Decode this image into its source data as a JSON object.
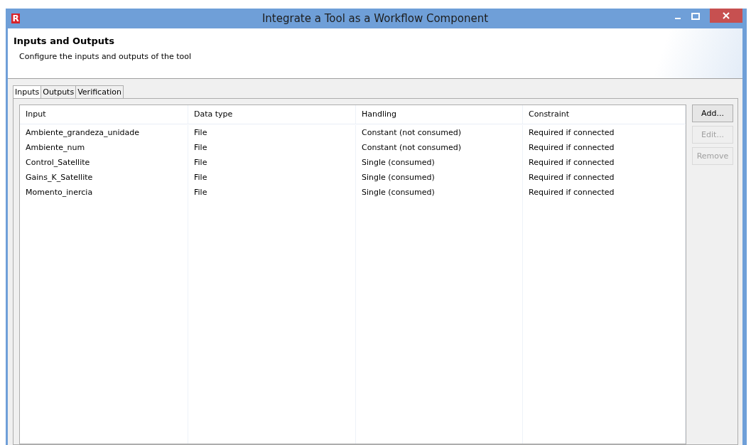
{
  "window": {
    "title": "Integrate a Tool as a Workflow Component",
    "logo": "R"
  },
  "header": {
    "title": "Inputs and Outputs",
    "description": "Configure the inputs and outputs of the tool"
  },
  "tabs": [
    {
      "label": "Inputs",
      "selected": true
    },
    {
      "label": "Outputs",
      "selected": false
    },
    {
      "label": "Verification",
      "selected": false
    }
  ],
  "table": {
    "columns": [
      "Input",
      "Data type",
      "Handling",
      "Constraint"
    ],
    "rows": [
      [
        "Ambiente_grandeza_unidade",
        "File",
        "Constant (not consumed)",
        "Required if connected"
      ],
      [
        "Ambiente_num",
        "File",
        "Constant (not consumed)",
        "Required if connected"
      ],
      [
        "Control_Satellite",
        "File",
        "Single (consumed)",
        "Required if connected"
      ],
      [
        "Gains_K_Satellite",
        "File",
        "Single (consumed)",
        "Required if connected"
      ],
      [
        "Momento_inercia",
        "File",
        "Single (consumed)",
        "Required if connected"
      ]
    ]
  },
  "buttons": [
    {
      "label": "Add...",
      "disabled": false
    },
    {
      "label": "Edit...",
      "disabled": true
    },
    {
      "label": "Remove",
      "disabled": true
    }
  ]
}
